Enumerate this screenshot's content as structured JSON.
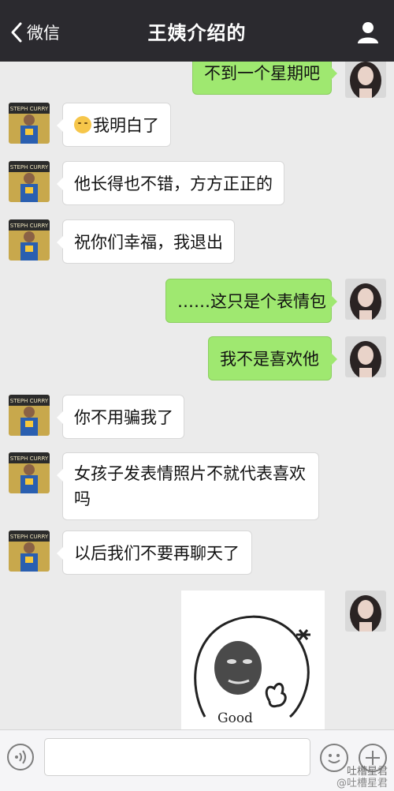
{
  "header": {
    "back_label": "微信",
    "title": "王姨介绍的"
  },
  "left_avatar": {
    "jersey_text": "STEPH CURRY"
  },
  "messages": [
    {
      "side": "right",
      "text": "不到一个星期吧"
    },
    {
      "side": "left",
      "emoji": "smiling-face",
      "text": "我明白了"
    },
    {
      "side": "left",
      "text": "他长得也不错，方方正正的"
    },
    {
      "side": "left",
      "text": "祝你们幸福，我退出"
    },
    {
      "side": "right",
      "text": "……这只是个表情包"
    },
    {
      "side": "right",
      "text": "我不是喜欢他"
    },
    {
      "side": "left",
      "text": "你不用骗我了"
    },
    {
      "side": "left",
      "text": "女孩子发表情照片不就代表喜欢吗"
    },
    {
      "side": "left",
      "text": "以后我们不要再聊天了"
    },
    {
      "side": "right",
      "type": "sticker",
      "caption": "Good"
    }
  ],
  "input_bar": {
    "input_value": "",
    "icons": [
      "voice-icon",
      "emoji-icon",
      "plus-icon"
    ]
  },
  "watermark": {
    "line1": "吐槽星君",
    "line2": "@吐槽星君"
  },
  "colors": {
    "header_bg": "#2b2a2f",
    "chat_bg": "#ebebeb",
    "bubble_left": "#ffffff",
    "bubble_right": "#9fe870"
  }
}
